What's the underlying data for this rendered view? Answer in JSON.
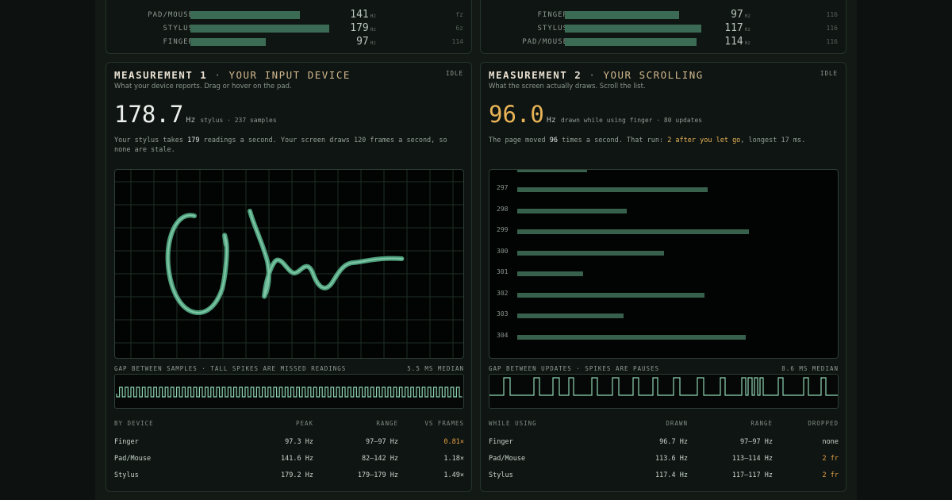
{
  "top_left": {
    "rows": [
      {
        "label": "PAD/MOUSE",
        "value": "141",
        "unit": "Hz",
        "side": "fz",
        "bar_fraction": 0.79
      },
      {
        "label": "STYLUS",
        "value": "179",
        "unit": "Hz",
        "side": "6z",
        "bar_fraction": 1.0
      },
      {
        "label": "FINGER",
        "value": "97",
        "unit": "Hz",
        "side": "114",
        "bar_fraction": 0.54
      }
    ]
  },
  "top_right": {
    "rows": [
      {
        "label": "FINGER",
        "value": "97",
        "unit": "Hz",
        "side": "116",
        "bar_fraction": 0.82
      },
      {
        "label": "STYLUS",
        "value": "117",
        "unit": "Hz",
        "side": "116",
        "bar_fraction": 0.98
      },
      {
        "label": "PAD/MOUSE",
        "value": "114",
        "unit": "Hz",
        "side": "116",
        "bar_fraction": 0.95
      }
    ]
  },
  "m1": {
    "title": "MEASUREMENT 1",
    "separator": "·",
    "subtitle": "YOUR INPUT DEVICE",
    "state": "IDLE",
    "description": "What your device reports. Drag or hover on the pad.",
    "big_value": "178.7",
    "big_unit": "Hz",
    "big_note": "stylus · 237 samples",
    "para_a": "Your stylus takes ",
    "para_b": "179",
    "para_c": " readings a second. Your screen draws 120 frames a second, so none are stale.",
    "caption": "GAP BETWEEN SAMPLES · TALL SPIKES ARE MISSED READINGS",
    "caption_right": "5.5 MS MEDIAN",
    "headers": [
      "BY DEVICE",
      "PEAK",
      "RANGE",
      "VS FRAMES"
    ],
    "rows": [
      [
        "Finger",
        "97.3 Hz",
        "97–97 Hz",
        "0.81×"
      ],
      [
        "Pad/Mouse",
        "141.6 Hz",
        "82–142 Hz",
        "1.18×"
      ],
      [
        "Stylus",
        "179.2 Hz",
        "179–179 Hz",
        "1.49×"
      ]
    ],
    "accent": "#6fd1a6"
  },
  "m2": {
    "title": "MEASUREMENT 2",
    "separator": "·",
    "subtitle": "YOUR SCROLLING",
    "state": "IDLE",
    "description": "What the screen actually draws. Scroll the list.",
    "big_value": "96.0",
    "big_unit": "Hz",
    "big_note": "drawn while using finger · 80 updates",
    "para_a": "The page moved ",
    "para_b": "96",
    "para_c": " times a second. That run: ",
    "para_d": "2 after you let go",
    "para_e": ", longest 17 ms.",
    "list": [
      {
        "num": "297",
        "fraction": 0.61
      },
      {
        "num": "298",
        "fraction": 0.35
      },
      {
        "num": "299",
        "fraction": 0.74
      },
      {
        "num": "300",
        "fraction": 0.47
      },
      {
        "num": "301",
        "fraction": 0.21
      },
      {
        "num": "302",
        "fraction": 0.6
      },
      {
        "num": "303",
        "fraction": 0.34
      },
      {
        "num": "304",
        "fraction": 0.73
      }
    ],
    "caption": "GAP BETWEEN UPDATES · SPIKES ARE PAUSES",
    "caption_right": "8.6 MS MEDIAN",
    "headers": [
      "WHILE USING",
      "DRAWN",
      "RANGE",
      "DROPPED"
    ],
    "rows": [
      [
        "Finger",
        "96.7 Hz",
        "97–97 Hz",
        "none"
      ],
      [
        "Pad/Mouse",
        "113.6 Hz",
        "113–114 Hz",
        "2 fr"
      ],
      [
        "Stylus",
        "117.4 Hz",
        "117–117 Hz",
        "2 fr"
      ]
    ],
    "accent": "#e9b457"
  }
}
